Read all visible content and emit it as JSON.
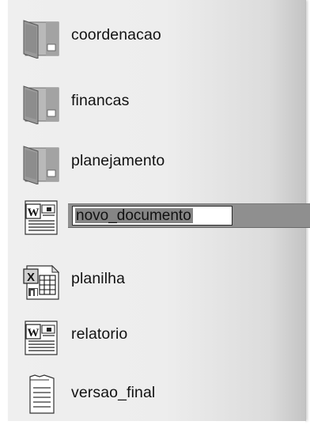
{
  "files": [
    {
      "name": "coordenacao",
      "kind": "folder",
      "icon": "folder-icon"
    },
    {
      "name": "financas",
      "kind": "folder",
      "icon": "folder-icon"
    },
    {
      "name": "planejamento",
      "kind": "folder",
      "icon": "folder-icon"
    },
    {
      "name": "novo_documento",
      "kind": "word",
      "icon": "word-document-icon",
      "selected": true
    },
    {
      "name": "planilha",
      "kind": "excel",
      "icon": "excel-spreadsheet-icon"
    },
    {
      "name": "relatorio",
      "kind": "word",
      "icon": "word-document-icon"
    },
    {
      "name": "versao_final",
      "kind": "text",
      "icon": "text-document-icon"
    }
  ],
  "icon_labels": {
    "word_letter": "W",
    "excel_letter": "X"
  },
  "colors": {
    "selection_band": "#8f8f8f",
    "rename_highlight": "#858585"
  }
}
